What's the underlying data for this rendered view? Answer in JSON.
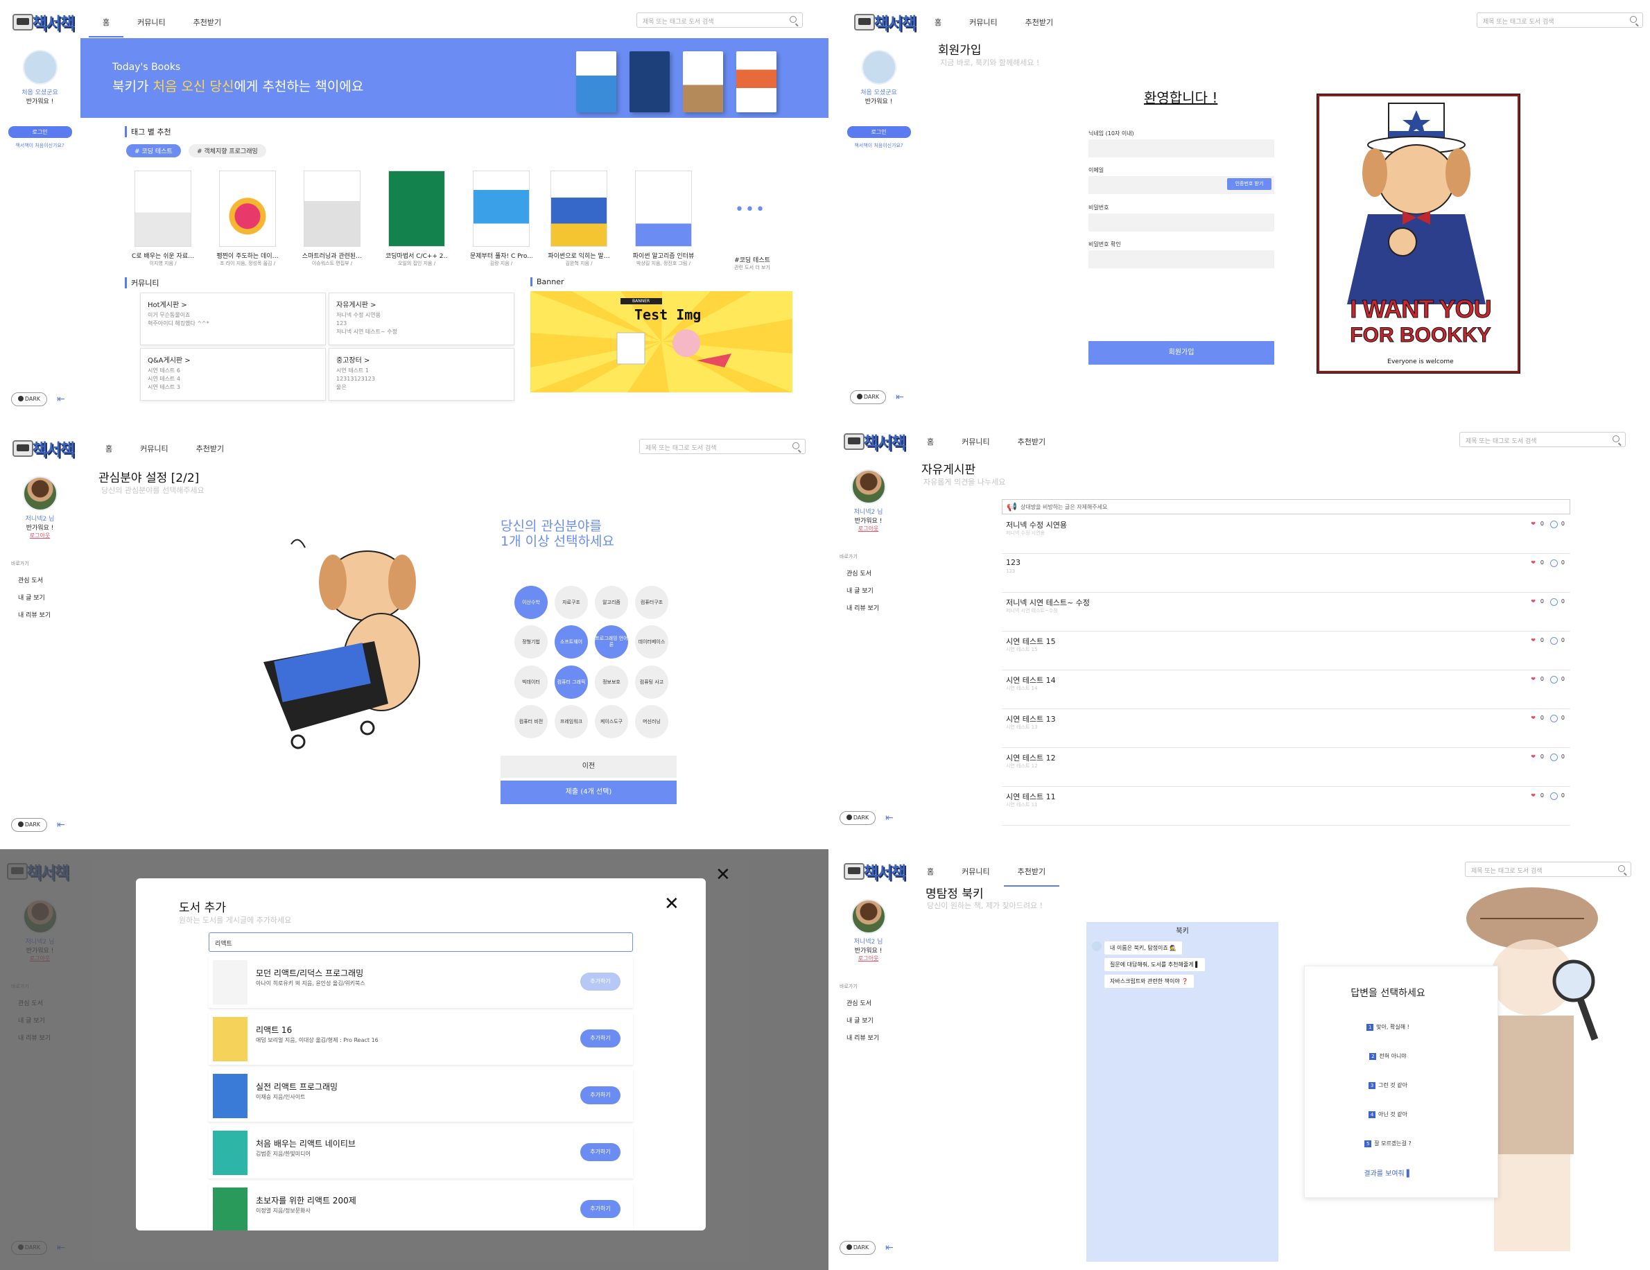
{
  "common": {
    "nav": {
      "home": "홈",
      "community": "커뮤니티",
      "recommend": "추천받기"
    },
    "search_placeholder": "제목 또는 태그로 도서 검색",
    "dark_label": "DARK",
    "collapse_glyph": "⇤",
    "menu": {
      "title": "바로가기",
      "items": [
        "관심 도서",
        "내 글 보기",
        "내 리뷰 보기"
      ]
    },
    "guest": {
      "line1": "처음 오셨군요",
      "line2": "반가워요 !",
      "login": "로그인",
      "first_link": "책서책이 처음이신가요?"
    },
    "user": {
      "name": "저니넥2 님",
      "greet": "반가워요 !",
      "logout": "로그아웃"
    },
    "colors": {
      "accent": "#6b8df3",
      "accent_dark": "#3c63d6",
      "chat_bg": "#d7e2fb",
      "banner": "#ffe95a"
    }
  },
  "home": {
    "hero_small": "Today's Books",
    "hero_big_a": "북키가 ",
    "hero_big_hl1": "처음 오신 당신",
    "hero_big_b": "에게 추천하는 책이에요",
    "section_tags": "태그 별 추천",
    "tags": [
      "# 코딩 테스트",
      "# 객체지향 프로그래밍"
    ],
    "books": [
      {
        "title": "C로 배우는 쉬운 자료…",
        "author": "이지영 지음 /"
      },
      {
        "title": "펭찐이 주도하는 데이…",
        "author": "조 라이 지음, 정성목 옮김 /"
      },
      {
        "title": "스마트러닝과 관련된…",
        "author": "이슈워스트 편집부 /"
      },
      {
        "title": "코딩마법서 C/C++ 2…",
        "author": "오일의 집인 지음 /"
      },
      {
        "title": "문제부터 풀자! C Pro…",
        "author": "김랑 지음 /"
      },
      {
        "title": "파이썬으로 익히는 말…",
        "author": "김완혁 지음 /"
      },
      {
        "title": "파이썬 알고리즘 인터뷰",
        "author": "박상길 지음, 정진호 그림 /"
      },
      {
        "title": "#코딩 테스트",
        "author": "관련 도서 더 보기"
      }
    ],
    "more_dots": "•••",
    "section_community": "커뮤니티",
    "section_banner": "Banner",
    "boards": [
      {
        "title": "Hot게시판 >",
        "lines": [
          "이거 무슨동물이죠",
          "혁주아이디 해킹했다 ^^*"
        ]
      },
      {
        "title": "자유게시판 >",
        "lines": [
          "저니넥 수정 시연용",
          "123",
          "저니넥 시연 테스트~ 수정"
        ]
      },
      {
        "title": "Q&A게시판 >",
        "lines": [
          "시연 테스트 6",
          "시연 테스트 4",
          "시연 테스트 3"
        ]
      },
      {
        "title": "중고장터 >",
        "lines": [
          "시연 테스트 1",
          "12313123123",
          "울은"
        ]
      }
    ],
    "banner_tag": "BANNER",
    "banner_text": "Test Img"
  },
  "signup": {
    "title": "회원가입",
    "sub": "지금 바로, 북키와 함께해세요 !",
    "welcome": "환영합니다 !",
    "fields": [
      "닉네임 (10자 이내)",
      "이메일",
      "비밀번호",
      "비밀번호 확인"
    ],
    "verify": "인증번호 받기",
    "submit": "회원가입",
    "poster_l1a": "I WANT ",
    "poster_l1b": "YOU",
    "poster_l2": "FOR BOOKKY",
    "poster_l3": "Everyone is welcome"
  },
  "interest": {
    "title": "관심분야 설정 [2/2]",
    "sub": "당신의 관심분야를 선택해주세요",
    "pick_l1": "당신의 관심분야를",
    "pick_l2": "1개 이상 선택하세요",
    "options": [
      {
        "label": "이산수학",
        "sel": true
      },
      {
        "label": "자료구조",
        "sel": false
      },
      {
        "label": "알고리즘",
        "sel": false
      },
      {
        "label": "컴퓨터구조",
        "sel": false
      },
      {
        "label": "정형기법",
        "sel": false
      },
      {
        "label": "소프트웨어",
        "sel": true
      },
      {
        "label": "프로그래밍 언어론",
        "sel": true
      },
      {
        "label": "데이터베이스",
        "sel": false
      },
      {
        "label": "빅데이터",
        "sel": false
      },
      {
        "label": "컴퓨터 그래픽",
        "sel": true
      },
      {
        "label": "정보보호",
        "sel": false
      },
      {
        "label": "컴퓨팅 사고",
        "sel": false
      },
      {
        "label": "컴퓨터 비전",
        "sel": false
      },
      {
        "label": "프레임워크",
        "sel": false
      },
      {
        "label": "케이스도구",
        "sel": false
      },
      {
        "label": "머신러닝",
        "sel": false
      }
    ],
    "prev": "이전",
    "submit": "제출 (4개 선택)"
  },
  "board": {
    "title": "자유게시판",
    "sub": "자유롭게 의견을 나누세요",
    "notice": "상대방을 비방하는 글은 자제해주세요",
    "posts": [
      {
        "title": "저니넥 수정 시연용",
        "sub": "저니넥 수정 시연용",
        "likes": "0",
        "comments": "0"
      },
      {
        "title": "123",
        "sub": "123",
        "likes": "0",
        "comments": "0"
      },
      {
        "title": "저니넥 시연 테스트~ 수정",
        "sub": "저니넥 시연 테스트~수정",
        "likes": "0",
        "comments": "0"
      },
      {
        "title": "시연 테스트 15",
        "sub": "시연 테스트 15",
        "likes": "0",
        "comments": "0"
      },
      {
        "title": "시연 테스트 14",
        "sub": "시연 테스트 14",
        "likes": "0",
        "comments": "0"
      },
      {
        "title": "시연 테스트 13",
        "sub": "시연 테스트 13",
        "likes": "0",
        "comments": "0"
      },
      {
        "title": "시연 테스트 12",
        "sub": "시연 테스트 12",
        "likes": "0",
        "comments": "0"
      },
      {
        "title": "시연 테스트 11",
        "sub": "시연 테스트 11",
        "likes": "0",
        "comments": "0"
      }
    ]
  },
  "addbook": {
    "title": "도서 추가",
    "sub": "원하는 도서를 게시글에 추가하세요",
    "query": "리액트",
    "add_label": "추가하기",
    "results": [
      {
        "title": "모던 리액트/리덕스 프로그래밍",
        "author": "아나이 히로유키 외 지음, 윤인성 옮김/위키북스"
      },
      {
        "title": "리액트 16",
        "author": "애덤 보리얼 지음, 이대상 옮김/형제 : Pro React 16"
      },
      {
        "title": "실전 리액트 프로그래밍",
        "author": "이재승 지음/인사이트"
      },
      {
        "title": "처음 배우는 리액트 네이티브",
        "author": "김범준 지음/한빛미디어"
      },
      {
        "title": "초보자를 위한 리액트 200제",
        "author": "이정열 지음/정보문화사"
      }
    ]
  },
  "detective": {
    "title": "명탐정 북키",
    "sub": "당신이 원하는 책, 제가 찾아드려요 !",
    "bot_name": "북키",
    "bubbles": [
      "내 이름은 북키, 탐정이죠 🕵",
      "질문에 대답해줘, 도서를 추천해줄게 ▌",
      "자바스크립트와 관련한 책이야 ❓"
    ],
    "answer_title": "답변을 선택하세요",
    "answers": [
      {
        "n": "1",
        "text": "맞아, 확실해 !"
      },
      {
        "n": "2",
        "text": "전혀 아니야"
      },
      {
        "n": "3",
        "text": "그런 것 같아"
      },
      {
        "n": "4",
        "text": "아닌 것 같아"
      },
      {
        "n": "5",
        "text": "잘 모르겠는걸 ?"
      }
    ],
    "result": "결과를 보여줘 ▌"
  }
}
